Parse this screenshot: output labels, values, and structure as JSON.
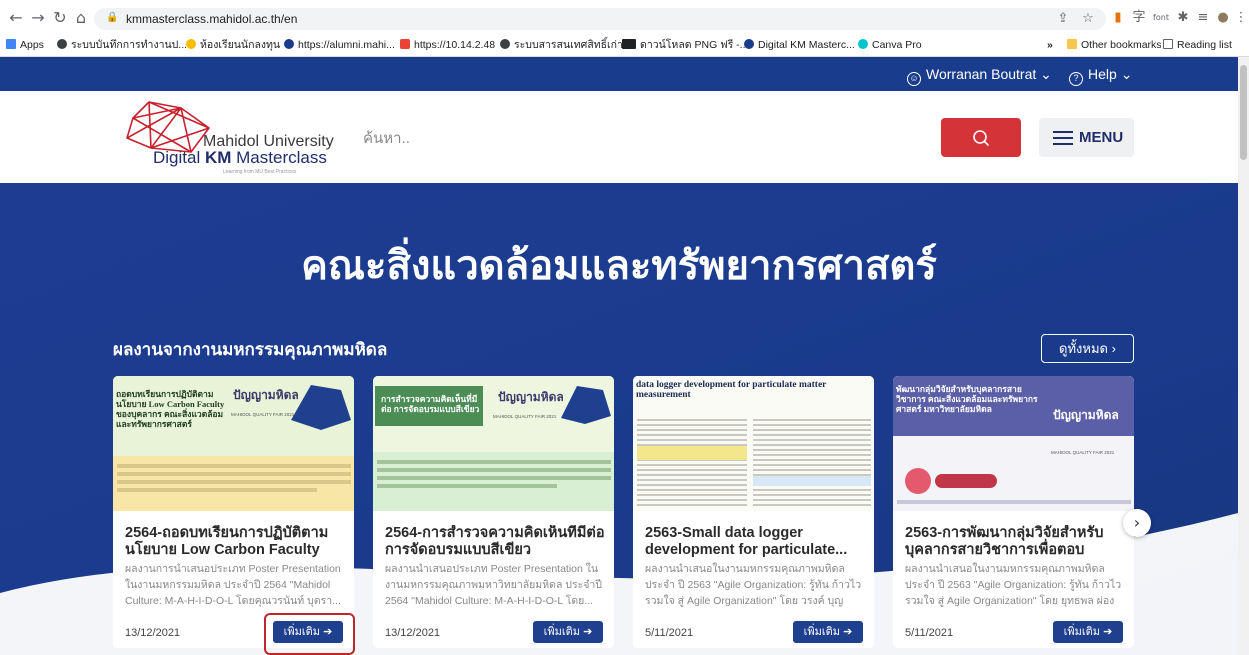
{
  "browser": {
    "url": "kmmasterclass.mahidol.ac.th/en",
    "bookmarks": [
      {
        "label": "Apps",
        "color": "#ea4335"
      },
      {
        "label": "ระบบบันทึกการทำงานป...",
        "color": "#3c4043"
      },
      {
        "label": "ห้องเรียนนักลงทุน",
        "color": "#fbbc04"
      },
      {
        "label": "https://alumni.mahi...",
        "color": "#1a3a8a"
      },
      {
        "label": "https://10.14.2.48",
        "color": "#ea4335"
      },
      {
        "label": "ระบบสารสนเทศสิทธิ์เก่า",
        "color": "#3c4043"
      },
      {
        "label": "ดาวน์โหลด PNG ฟรี -...",
        "color": "#202124"
      },
      {
        "label": "Digital KM Masterc...",
        "color": "#1a3a8a"
      },
      {
        "label": "Canva Pro",
        "color": "#00c4cc"
      }
    ],
    "overflow": "»",
    "other_bookmarks": "Other bookmarks",
    "reading_list": "Reading list"
  },
  "topbar": {
    "user": "Worranan Boutrat",
    "help": "Help"
  },
  "header": {
    "logo_line1": "Mahidol University",
    "logo_line2_a": "Digital ",
    "logo_line2_b": "KM",
    "logo_line2_c": " Masterclass",
    "logo_tagline": "Learning from MU Best Practices",
    "search_placeholder": "ค้นหา..",
    "menu_label": "MENU"
  },
  "hero": {
    "title": "คณะสิ่งแวดล้อมและทรัพยากรศาสตร์",
    "section_title": "ผลงานจากงานมหกรรมคุณภาพมหิดล",
    "see_all": "ดูทั้งหมด  ›"
  },
  "cards": [
    {
      "title": "2564-ถอดบทเรียนการปฏิบัติตามนโยบาย Low Carbon Faculty ขอ...",
      "desc": "ผลงานการนำเสนอประเภท Poster Presentation ในงานมหกรรมมหิดล ประจำปี 2564 \"Mahidol Culture: M-A-H-I-D-O-L โดยคุณวรนันท์ บุตรา...",
      "date": "13/12/2021",
      "more": "เพิ่มเติม",
      "poster_head": "ถอดบทเรียนการปฏิบัติตามนโยบาย Low Carbon Faculty ของบุคลากร คณะสิ่งแวดล้อมและทรัพยากรศาสตร์"
    },
    {
      "title": "2564-การสำรวจความคิดเห็นที่มีต่อการจัดอบรมแบบสีเขียว",
      "desc": "ผลงานนำเสนอประเภท Poster Presentation ใน งานมหกรรมคุณภาพมหาวิทยาลัยมหิดล ประจำปี 2564 \"Mahidol Culture: M-A-H-I-D-O-L โดย...",
      "date": "13/12/2021",
      "more": "เพิ่มเติม",
      "poster_head": "การสำรวจความคิดเห็นที่มีต่อ การจัดอบรมแบบสีเขียว"
    },
    {
      "title": "2563-Small data logger development for particulate...",
      "desc": "ผลงานนำเสนอในงานมหกรรมคุณภาพมหิดลประจำ ปี 2563 \"Agile Organization: รู้ทัน ก้าวไว รวมใจ สู่ Agile Organization\" โดย วรงค์ บุญเชิดชู...",
      "date": "5/11/2021",
      "more": "เพิ่มเติม",
      "poster_head": "data logger development for particulate matter measurement"
    },
    {
      "title": "2563-การพัฒนากลุ่มวิจัยสำหรับบุคลากรสายวิชาการเพื่อตอบสนอง...",
      "desc": "ผลงานนำเสนอในงานมหกรรมคุณภาพมหิดลประจำ ปี 2563 \"Agile Organization: รู้ทัน ก้าวไว รวมใจ สู่ Agile Organization\" โดย ยุทธพล ผ่องพลีศา...",
      "date": "5/11/2021",
      "more": "เพิ่มเติม",
      "poster_head": "พัฒนากลุ่มวิจัยสำหรับบุคลากรสายวิชาการ คณะสิ่งแวดล้อมและทรัพยากรศาสตร์ มหาวิทยาลัยมหิดล"
    }
  ],
  "poster_brand": "ปัญญามหิดล",
  "fair_label": "MAHIDOL QUALITY FAIR 2021",
  "colors": {
    "brand_navy": "#1b3a8b",
    "search_red": "#d43337",
    "highlight_red": "#c0272d"
  }
}
